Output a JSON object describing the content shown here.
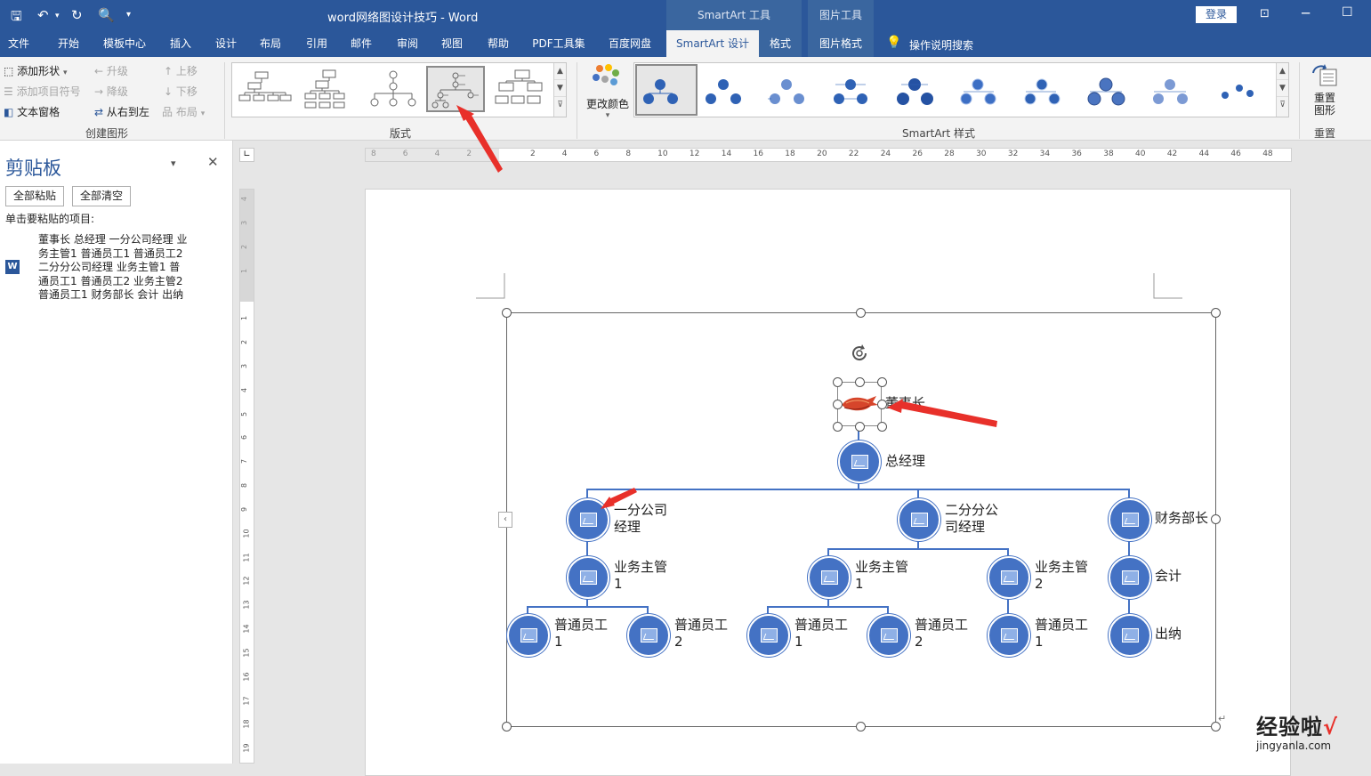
{
  "app": {
    "title": "word网络图设计技巧  -  Word",
    "login_label": "登录",
    "context_smartart": "SmartArt 工具",
    "context_picture": "图片工具"
  },
  "tabs": [
    {
      "label": "文件"
    },
    {
      "label": "开始"
    },
    {
      "label": "模板中心"
    },
    {
      "label": "插入"
    },
    {
      "label": "设计"
    },
    {
      "label": "布局"
    },
    {
      "label": "引用"
    },
    {
      "label": "邮件"
    },
    {
      "label": "审阅"
    },
    {
      "label": "视图"
    },
    {
      "label": "帮助"
    },
    {
      "label": "PDF工具集"
    },
    {
      "label": "百度网盘"
    },
    {
      "label": "SmartArt 设计"
    },
    {
      "label": "格式"
    },
    {
      "label": "图片格式"
    }
  ],
  "tell_me": "操作说明搜索",
  "ribbon": {
    "create": {
      "add_shape": "添加形状",
      "promote": "升级",
      "move_up": "上移",
      "add_bullet": "添加项目符号",
      "demote": "降级",
      "move_down": "下移",
      "text_pane": "文本窗格",
      "right_to_left": "从右到左",
      "layout": "布局",
      "group_label": "创建图形"
    },
    "layouts_label": "版式",
    "change_colors": "更改颜色",
    "styles_label": "SmartArt 样式",
    "reset_graphic": "重置图形",
    "reset_label": "重置"
  },
  "clipboard": {
    "title": "剪贴板",
    "paste_all": "全部粘贴",
    "clear_all": "全部清空",
    "instruction": "单击要粘贴的项目:",
    "item_lines": [
      "董事长 总经理 一分公司经理 业",
      "务主管1 普通员工1 普通员工2",
      "二分分公司经理 业务主管1 普",
      "通员工1 普通员工2 业务主管2",
      "普通员工1 财务部长 会计 出纳"
    ]
  },
  "ruler": {
    "h_labels": [
      "8",
      "6",
      "4",
      "2",
      "",
      "2",
      "4",
      "6",
      "8",
      "10",
      "12",
      "14",
      "16",
      "18",
      "20",
      "22",
      "24",
      "26",
      "28",
      "30",
      "32",
      "34",
      "36",
      "38",
      "40",
      "42",
      "44",
      "46",
      "48"
    ],
    "v_labels": [
      "4",
      "3",
      "2",
      "1",
      "",
      "1",
      "2",
      "3",
      "4",
      "5",
      "6",
      "7",
      "8",
      "9",
      "10",
      "11",
      "12",
      "13",
      "14",
      "15",
      "16",
      "17",
      "18",
      "19"
    ]
  },
  "org": {
    "chairman": "董事长",
    "gm": "总经理",
    "branch1": [
      "一分公司",
      "经理"
    ],
    "branch2": [
      "二分分公",
      "司经理"
    ],
    "finance": "财务部长",
    "sup1": [
      "业务主管",
      "1"
    ],
    "sup2a": [
      "业务主管",
      "1"
    ],
    "sup2b": [
      "业务主管",
      "2"
    ],
    "accountant": "会计",
    "cashier": "出纳",
    "emp1": [
      "普通员工",
      "1"
    ],
    "emp2": [
      "普通员工",
      "2"
    ],
    "emp3": [
      "普通员工",
      "1"
    ],
    "emp4": [
      "普通员工",
      "2"
    ],
    "emp5": [
      "普通员工",
      "1"
    ]
  },
  "watermark": "经验啦",
  "watermark_url": "jingyanla.com"
}
